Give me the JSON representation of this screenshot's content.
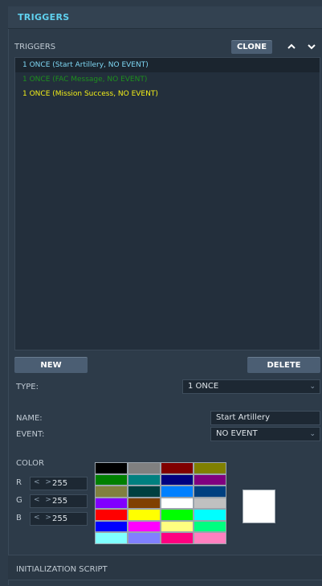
{
  "header": {
    "title": "TRIGGERS"
  },
  "triggers": {
    "section_label": "TRIGGERS",
    "clone_label": "CLONE",
    "up_arrow": "^",
    "down_arrow": "v",
    "items": [
      {
        "label": "1 ONCE (Start Artillery, NO EVENT)",
        "color": "#7fd8f5"
      },
      {
        "label": "1 ONCE (FAC Message, NO EVENT)",
        "color": "#1e8f1e"
      },
      {
        "label": "1 ONCE (Mission Success, NO EVENT)",
        "color": "#f2ee19"
      }
    ],
    "new_label": "NEW",
    "delete_label": "DELETE"
  },
  "type": {
    "label": "TYPE:",
    "value": "1 ONCE"
  },
  "name": {
    "label": "NAME:",
    "value": "Start Artillery"
  },
  "event": {
    "label": "EVENT:",
    "value": "NO EVENT"
  },
  "color": {
    "label": "COLOR",
    "r_label": "R",
    "r_value": "255",
    "g_label": "G",
    "g_value": "255",
    "b_label": "B",
    "b_value": "255",
    "palette": [
      "#000000",
      "#808080",
      "#800000",
      "#808000",
      "#008000",
      "#008080",
      "#000080",
      "#800080",
      "#808040",
      "#004040",
      "#0080ff",
      "#004080",
      "#8000ff",
      "#804000",
      "#ffffff",
      "#c0c0c0",
      "#ff0000",
      "#ffff00",
      "#00ff00",
      "#00ffff",
      "#0000ff",
      "#ff00ff",
      "#ffff80",
      "#00ff80",
      "#80ffff",
      "#8080ff",
      "#ff0080",
      "#ff80c0"
    ],
    "preview": "#ffffff"
  },
  "init_script": {
    "label": "INITIALIZATION SCRIPT"
  }
}
